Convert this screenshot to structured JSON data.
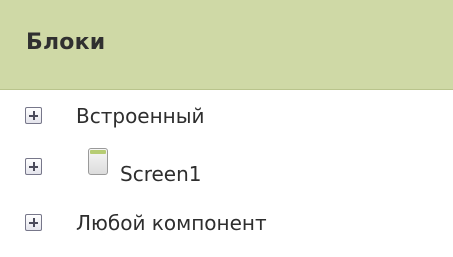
{
  "panel": {
    "title": "Блоки",
    "items": [
      {
        "label": "Встроенный",
        "icon": "plus-expand-icon"
      },
      {
        "label": "Screen1",
        "icon": "plus-expand-icon",
        "component_icon": "screen-icon"
      },
      {
        "label": "Любой компонент",
        "icon": "plus-expand-icon"
      }
    ]
  },
  "colors": {
    "header_background": "#cfd9a6",
    "text": "#2e2e2e"
  }
}
